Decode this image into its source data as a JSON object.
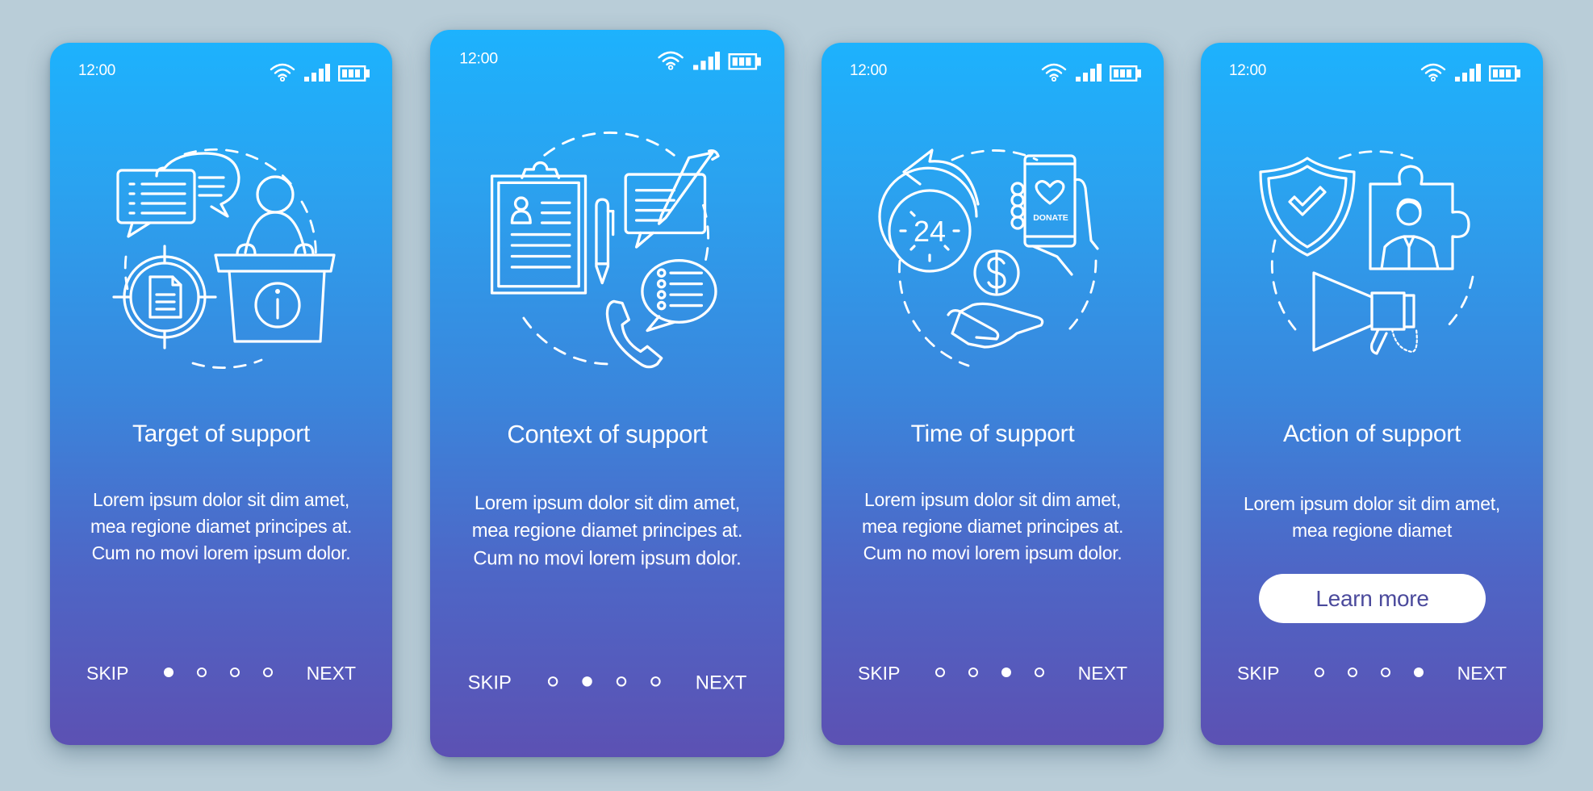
{
  "theme": {
    "gradient_top": "#1db2fd",
    "gradient_bottom": "#5c51b3",
    "background": "#b9cdd8",
    "button_text": "#4b4a9c"
  },
  "status_bar": {
    "time": "12:00",
    "icons": [
      "wifi-icon",
      "signal-icon",
      "battery-icon"
    ]
  },
  "nav": {
    "skip_label": "SKIP",
    "next_label": "NEXT",
    "total_steps": 4
  },
  "screens": [
    {
      "id": "target",
      "illustration": "speaker-podium-target-illustration",
      "title": "Target of support",
      "body": "Lorem ipsum dolor sit dim amet, mea regione diamet principes at. Cum no movi lorem ipsum dolor.",
      "active_step": 1
    },
    {
      "id": "context",
      "illustration": "clipboard-chat-phone-illustration",
      "title": "Context of support",
      "body": "Lorem ipsum dolor sit dim amet, mea regione diamet principes at. Cum no movi lorem ipsum dolor.",
      "active_step": 2
    },
    {
      "id": "time",
      "illustration": "24h-donate-illustration",
      "title": "Time of support",
      "body": "Lorem ipsum dolor sit dim amet, mea regione diamet principes at. Cum no movi lorem ipsum dolor.",
      "donate_label": "DONATE",
      "clock_label": "24",
      "active_step": 3
    },
    {
      "id": "action",
      "illustration": "shield-puzzle-megaphone-illustration",
      "title": "Action of support",
      "body": "Lorem ipsum dolor sit dim amet, mea regione diamet",
      "button_label": "Learn more",
      "active_step": 4
    }
  ]
}
